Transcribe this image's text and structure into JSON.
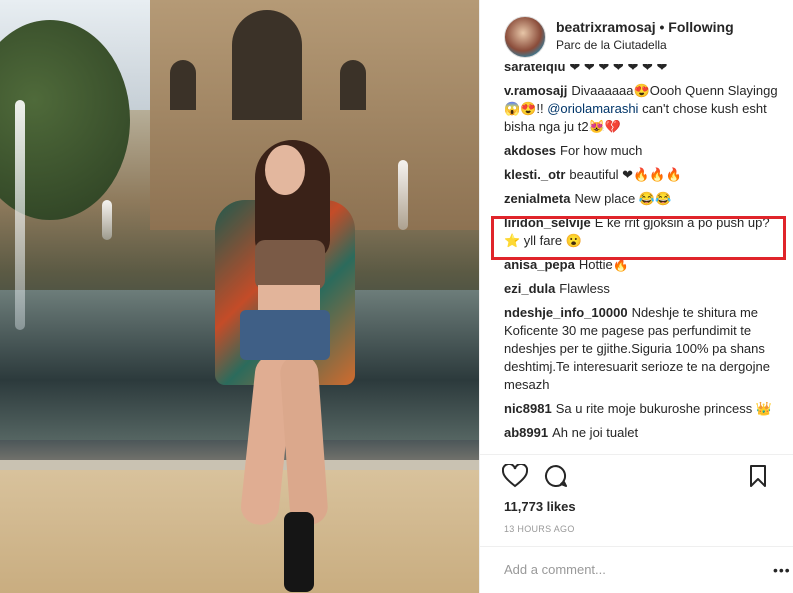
{
  "header": {
    "username": "beatrixramosaj",
    "separator": "•",
    "follow_status": "Following",
    "location": "Parc de la Ciutadella"
  },
  "comments": [
    {
      "user": "sarateiqiu",
      "text": "❤ ❤ ❤ ❤ ❤ ❤ ❤"
    },
    {
      "user": "v.ramosajj",
      "text": "Divaaaaaa😍Oooh Quenn Slayingg😱😍!! ",
      "mention": "@oriolamarashi",
      "text2": " can't chose kush esht bisha nga ju t2😻💔"
    },
    {
      "user": "akdoses",
      "text": "For how much"
    },
    {
      "user": "klesti._otr",
      "text": "beautiful ❤🔥🔥🔥"
    },
    {
      "user": "zenialmeta",
      "text": "New place 😂😂"
    },
    {
      "user": "liridon_selvije",
      "text": "E ke rrit gjoksin a po push up? ⭐ yll fare 😮"
    },
    {
      "user": "anisa_pepa",
      "text": "Hottie🔥"
    },
    {
      "user": "ezi_dula",
      "text": "Flawless"
    },
    {
      "user": "ndeshje_info_10000",
      "text": "Ndeshje te shitura me Koficente 30 me pagese pas perfundimit te ndeshjes per te gjithe.Siguria 100% pa shans deshtimj.Te interesuarit serioze te na dergojne mesazh"
    },
    {
      "user": "nic8981",
      "text": "Sa u rite moje bukuroshe princess 👑"
    },
    {
      "user": "ab8991",
      "text": "Ah ne joi tualet"
    }
  ],
  "icons": {
    "like": "heart-icon",
    "comment": "comment-icon",
    "save": "bookmark-icon",
    "more": "more-options-icon"
  },
  "likes": "11,773 likes",
  "timestamp": "13 HOURS AGO",
  "add_comment": {
    "placeholder": "Add a comment..."
  },
  "more_glyph": "•••",
  "highlight_color": "#e0242a"
}
